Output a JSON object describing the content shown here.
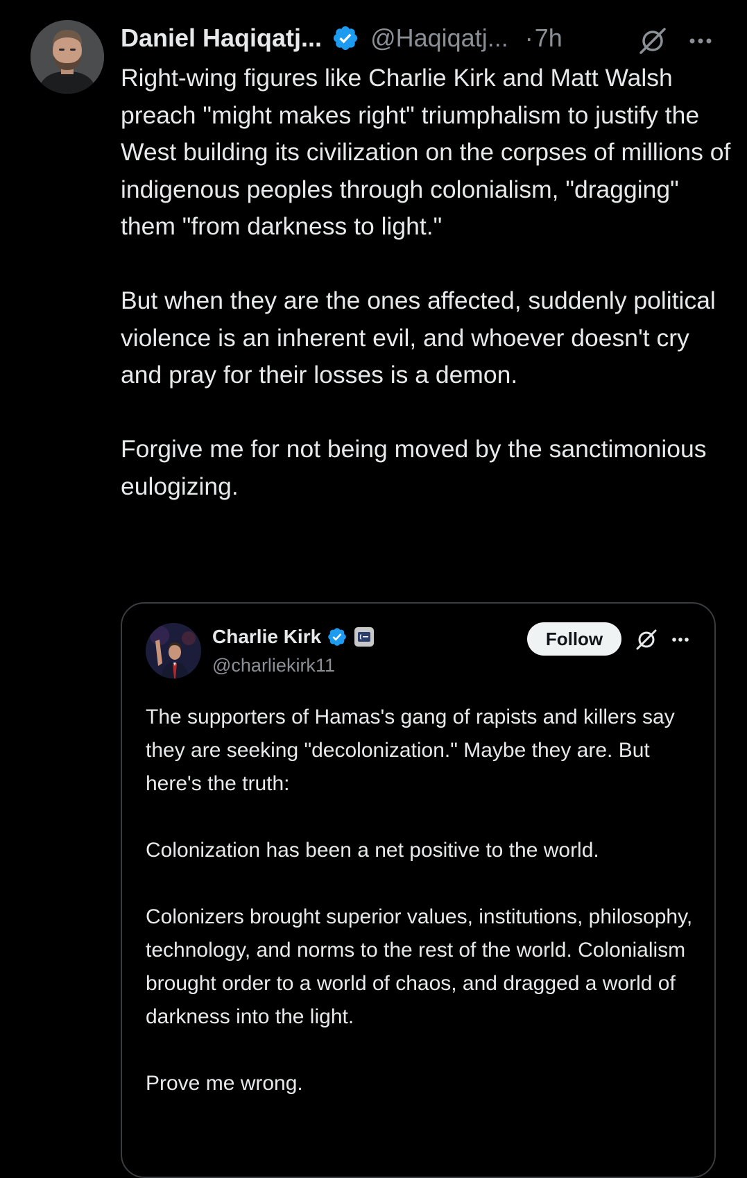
{
  "post": {
    "display_name": "Daniel Haqiqatj...",
    "handle": "@Haqiqatj...",
    "separator": "·",
    "time": "7h",
    "paragraphs": [
      "Right-wing figures like Charlie Kirk and Matt Walsh preach \"might makes right\" triumphalism to justify the West building its civilization on the corpses of millions of indigenous peoples through colonialism, \"dragging\" them \"from darkness to light.\"",
      "But when they are the ones affected, suddenly political violence is an inherent evil, and whoever doesn't cry and pray for their losses is a demon.",
      "Forgive me for not being moved by the sanctimonious eulogizing."
    ],
    "icons": {
      "verified": "verified-badge-icon",
      "grok": "grok-icon",
      "more": "more-icon"
    }
  },
  "quote": {
    "display_name": "Charlie Kirk",
    "handle": "@charliekirk11",
    "follow_label": "Follow",
    "paragraphs": [
      "The supporters of Hamas's gang of rapists and killers say they are seeking \"decolonization.\" Maybe they are. But here's the truth:",
      "Colonization has been a net positive to the world.",
      "Colonizers brought superior values, institutions, philosophy, technology, and norms to the rest of the world. Colonialism brought order to a world of chaos, and dragged a world of darkness into the light.",
      "Prove me wrong."
    ],
    "icons": {
      "verified": "verified-badge-icon",
      "affiliate": "affiliate-badge-icon",
      "grok": "grok-icon",
      "more": "more-icon"
    }
  },
  "colors": {
    "background": "#000000",
    "text": "#e7e9ea",
    "secondary": "#8b9097",
    "verified": "#1d9bf0",
    "border": "#3a3d40"
  }
}
